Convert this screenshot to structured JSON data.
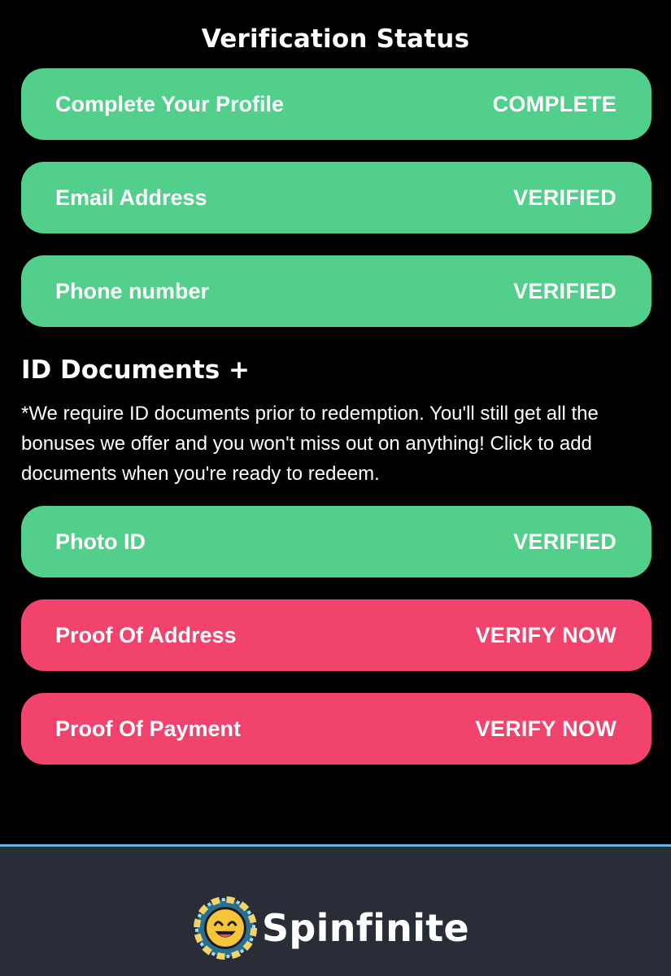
{
  "header": {
    "title": "Verification Status"
  },
  "verification_items": [
    {
      "label": "Complete Your Profile",
      "status": "COMPLETE"
    },
    {
      "label": "Email Address",
      "status": "VERIFIED"
    },
    {
      "label": "Phone number",
      "status": "VERIFIED"
    }
  ],
  "id_documents": {
    "heading": "ID Documents +",
    "notice": "*We require ID documents prior to redemption. You'll still get all the bonuses we offer and you won't miss out on anything! Click to add documents when you're ready to redeem.",
    "items": [
      {
        "label": "Photo ID",
        "status": "VERIFIED"
      },
      {
        "label": "Proof Of Address",
        "status": "VERIFY NOW"
      },
      {
        "label": "Proof Of Payment",
        "status": "VERIFY NOW"
      }
    ]
  },
  "footer": {
    "brand_name": "Spinfinite",
    "logo_icon": "spinfinite-chip-logo-icon"
  },
  "colors": {
    "background": "#000000",
    "verified_green": "#52cf8a",
    "action_red": "#f2436d",
    "footer_bg": "#282d37",
    "footer_border": "#63b5e6"
  }
}
